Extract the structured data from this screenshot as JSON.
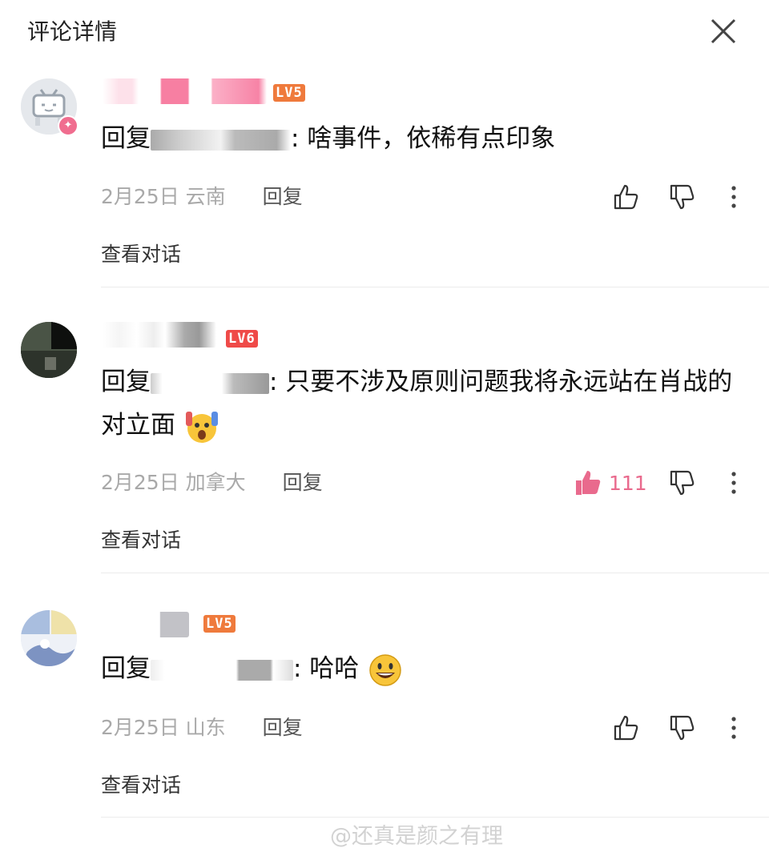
{
  "header": {
    "title": "评论详情",
    "close_icon": "close-icon"
  },
  "comments": [
    {
      "level": "LV5",
      "level_color": "#ef7a3c",
      "reply_prefix": "回复",
      "text": ": 啥事件，依稀有点印象",
      "date": "2月25日",
      "location": "云南",
      "reply_label": "回复",
      "liked": false,
      "view_conversation": "查看对话"
    },
    {
      "level": "LV6",
      "level_color": "#ef4a48",
      "reply_prefix": "回复",
      "text": ": 只要不涉及原则问题我将永远站在肖战的对立面",
      "emoji": "shocked-emoji",
      "date": "2月25日",
      "location": "加拿大",
      "reply_label": "回复",
      "liked": true,
      "like_count": "111",
      "view_conversation": "查看对话"
    },
    {
      "level": "LV5",
      "level_color": "#ef7a3c",
      "reply_prefix": "回复",
      "text": ": 哈哈",
      "emoji": "smile-emoji",
      "date": "2月25日",
      "location": "山东",
      "reply_label": "回复",
      "liked": false,
      "view_conversation": "查看对话"
    }
  ],
  "colors": {
    "like_active": "#e96a8d",
    "meta_text": "#a9a9a9"
  },
  "watermark": "@还真是颜之有理"
}
